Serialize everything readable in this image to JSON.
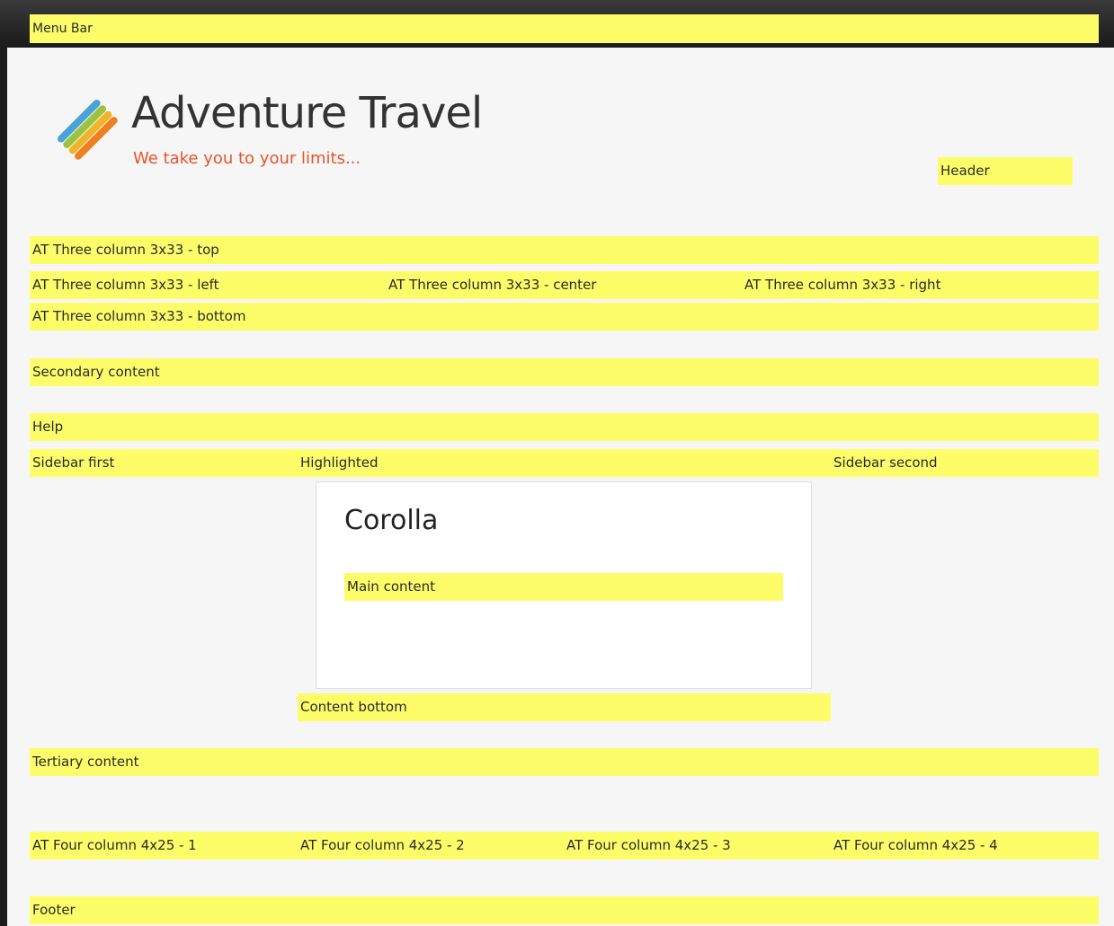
{
  "menu_bar": {
    "label": "Menu Bar"
  },
  "header": {
    "site_name": "Adventure Travel",
    "slogan": "We take you to your limits...",
    "region_label": "Header",
    "logo_icon": "adventure-travel-logo"
  },
  "three_column": {
    "top": "AT Three column 3x33 - top",
    "left": "AT Three column 3x33 - left",
    "center": "AT Three column 3x33 - center",
    "right": "AT Three column 3x33 - right",
    "bottom": "AT Three column 3x33 - bottom"
  },
  "secondary_content": "Secondary content",
  "help": "Help",
  "sidebar_first": "Sidebar first",
  "highlighted": "Highlighted",
  "sidebar_second": "Sidebar second",
  "main": {
    "title": "Corolla",
    "content_label": "Main content"
  },
  "content_bottom": "Content bottom",
  "tertiary_content": "Tertiary content",
  "four_column": {
    "col1": "AT Four column 4x25 - 1",
    "col2": "AT Four column 4x25 - 2",
    "col3": "AT Four column 4x25 - 3",
    "col4": "AT Four column 4x25 - 4"
  },
  "footer": "Footer",
  "colors": {
    "region_highlight": "#fdfd6a",
    "slogan": "#e8542a",
    "page_bg": "#f6f6f6",
    "chrome_bg": "#1c1c1c"
  }
}
